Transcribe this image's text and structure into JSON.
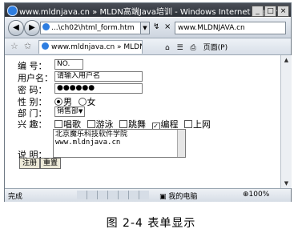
{
  "window": {
    "title": "www.mldnjava.cn » MLDN高端Java培训 - Windows Internet Explorer",
    "controls": [
      "_",
      "□",
      "×"
    ]
  },
  "toolbar": {
    "back_icon": "back-arrow-icon",
    "forward_icon": "forward-arrow-icon",
    "address": "...\\ch02\\html_form.htm",
    "refresh": "↯",
    "stop": "×",
    "search_value": "www.MLDNJAVA.cn"
  },
  "tabs": {
    "active_label": "www.mldnjava.cn » MLDN...",
    "tools": [
      "⌂",
      "☰",
      "⎙",
      "页面(P)"
    ]
  },
  "form": {
    "labels": {
      "id": "编 号：",
      "username": "用户名：",
      "password": "密 码：",
      "gender": "性 别：",
      "department": "部 门：",
      "interests": "兴 趣：",
      "note": "说 明："
    },
    "id_value": "NO.",
    "username_placeholder": "请输入用户名",
    "password_value": "●●●●●●",
    "gender_options": [
      "男",
      "女"
    ],
    "gender_selected": "男",
    "department_selected": "销售部",
    "interests": [
      {
        "label": "唱歌",
        "checked": false
      },
      {
        "label": "游泳",
        "checked": false
      },
      {
        "label": "跳舞",
        "checked": false
      },
      {
        "label": "编程",
        "checked": true
      },
      {
        "label": "上网",
        "checked": false
      }
    ],
    "note_lines": [
      "北京魔乐科技软件学院",
      "www.mldnjava.cn"
    ],
    "submit_label": "注册",
    "reset_label": "重置"
  },
  "status": {
    "left": "完成",
    "zone": "我的电脑",
    "zoom": "100%"
  },
  "caption": "图 2-4   表单显示"
}
